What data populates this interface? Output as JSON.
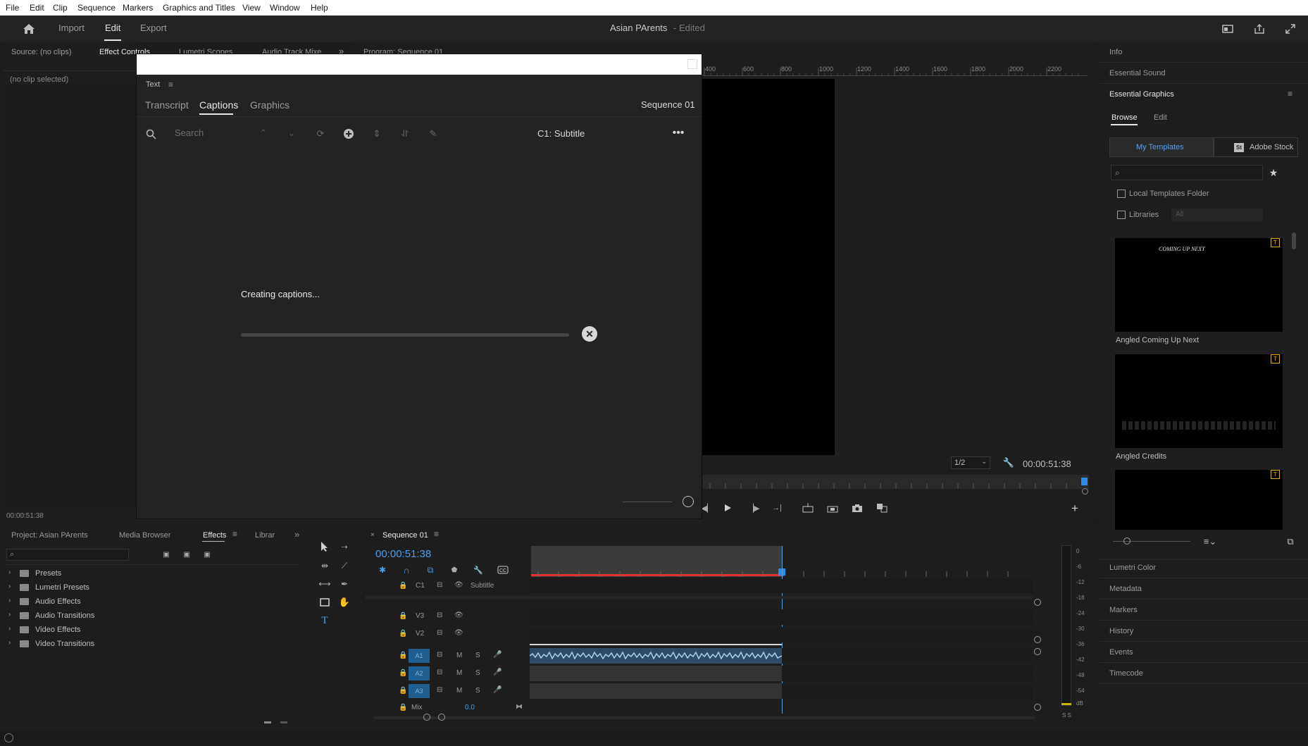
{
  "menu": [
    "File",
    "Edit",
    "Clip",
    "Sequence",
    "Markers",
    "Graphics and Titles",
    "View",
    "Window",
    "Help"
  ],
  "appbar": {
    "tabs": [
      "Import",
      "Edit",
      "Export"
    ],
    "project_title": "Asian PArents",
    "edited": "- Edited"
  },
  "source_panel": {
    "tabs": [
      "Source: (no clips)",
      "Effect Controls",
      "Lumetri Scopes",
      "Audio Track Mixe"
    ],
    "no_clip": "(no clip selected)",
    "timecode": "00:00:51:38"
  },
  "program_panel": {
    "title": "Program: Sequence 01",
    "ruler": [
      "400",
      "600",
      "800",
      "1000",
      "1200",
      "1400",
      "1600",
      "1800",
      "2000",
      "2200"
    ],
    "resolution": "1/2",
    "timecode": "00:00:51:38"
  },
  "text_dialog": {
    "title": "Text",
    "tabs": [
      "Transcript",
      "Captions",
      "Graphics"
    ],
    "active_tab": "Captions",
    "sequence": "Sequence 01",
    "search_placeholder": "Search",
    "track": "C1: Subtitle",
    "status": "Creating captions..."
  },
  "right_panel": {
    "info": "Info",
    "essential_sound": "Essential Sound",
    "essential_graphics": "Essential Graphics",
    "tabs": [
      "Browse",
      "Edit"
    ],
    "my_templates": "My Templates",
    "adobe_stock": "Adobe Stock",
    "stock_badge": "St",
    "local_templates": "Local Templates Folder",
    "libraries": "Libraries",
    "libraries_select": "All",
    "templates": [
      {
        "name": "Angled Coming Up Next",
        "preview_text": "COMING UP NEXT"
      },
      {
        "name": "Angled Credits",
        "preview_text": ""
      },
      {
        "name": "",
        "preview_text": ""
      }
    ],
    "bottom_items": [
      "Lumetri Color",
      "Metadata",
      "Markers",
      "History",
      "Events",
      "Timecode"
    ]
  },
  "project_panel": {
    "tabs": [
      "Project: Asian PArents",
      "Media Browser",
      "Effects",
      "Librar"
    ],
    "items": [
      "Presets",
      "Lumetri Presets",
      "Audio Effects",
      "Audio Transitions",
      "Video Effects",
      "Video Transitions"
    ]
  },
  "timeline": {
    "title": "Sequence 01",
    "timecode": "00:00:51:38",
    "caption_track": {
      "label": "C1",
      "name": "Subtitle"
    },
    "video_tracks": [
      "V3",
      "V2"
    ],
    "audio_tracks": [
      "A1",
      "A2",
      "A3"
    ],
    "mix_label": "Mix",
    "mix_value": "0.0",
    "buttons": {
      "mute": "M",
      "solo": "S"
    }
  },
  "meter": {
    "scale": [
      "0",
      "-6",
      "-12",
      "-18",
      "-24",
      "-30",
      "-36",
      "-42",
      "-48",
      "-54",
      "dB"
    ],
    "bottom": "S S"
  },
  "colors": {
    "accent": "#2d8ceb",
    "playhead": "#5a9fd6",
    "inout": "#e03030",
    "waveform": "#8cb8e0"
  }
}
